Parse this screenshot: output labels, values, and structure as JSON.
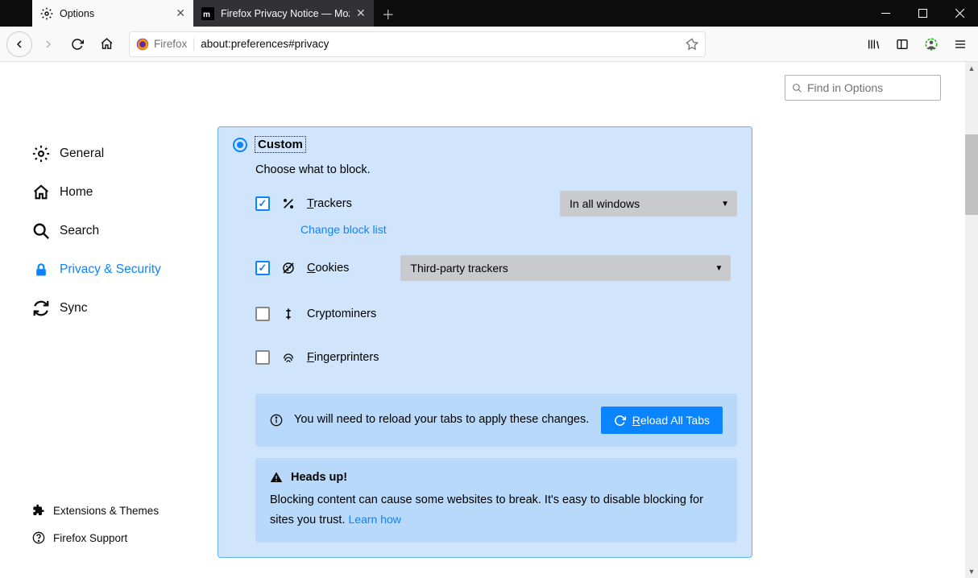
{
  "titlebar": {
    "tabs": [
      {
        "label": "Options",
        "icon": "gear-icon",
        "active": true
      },
      {
        "label": "Firefox Privacy Notice — Mozil",
        "icon": "mozilla-icon",
        "active": false
      }
    ]
  },
  "navbar": {
    "identity_label": "Firefox",
    "url": "about:preferences#privacy"
  },
  "search": {
    "placeholder": "Find in Options"
  },
  "sidebar": {
    "items": [
      {
        "label": "General",
        "icon": "gear-icon"
      },
      {
        "label": "Home",
        "icon": "home-icon"
      },
      {
        "label": "Search",
        "icon": "search-icon"
      },
      {
        "label": "Privacy & Security",
        "icon": "lock-icon",
        "active": true
      },
      {
        "label": "Sync",
        "icon": "sync-icon"
      }
    ],
    "footer": [
      {
        "label": "Extensions & Themes",
        "icon": "puzzle-icon"
      },
      {
        "label": "Firefox Support",
        "icon": "question-icon"
      }
    ]
  },
  "panel": {
    "title": "Custom",
    "subtitle": "Choose what to block.",
    "options": {
      "trackers": {
        "label_pre": "T",
        "label_rest": "rackers",
        "checked": true,
        "select": "In all windows"
      },
      "change_block_list": "Change block list",
      "cookies": {
        "label_pre": "C",
        "label_rest": "ookies",
        "checked": true,
        "select": "Third-party trackers"
      },
      "cryptominers": {
        "label": "Cryptominers",
        "checked": false
      },
      "fingerprinters": {
        "label_pre": "F",
        "label_rest": "ingerprinters",
        "checked": false
      }
    },
    "reload_notice": {
      "text": "You will need to reload your tabs to apply these changes.",
      "button_pre": "R",
      "button_rest": "eload All Tabs"
    },
    "warning": {
      "title": "Heads up!",
      "body": "Blocking content can cause some websites to break. It's easy to disable blocking for sites you trust.  ",
      "learn": "Learn how"
    }
  }
}
